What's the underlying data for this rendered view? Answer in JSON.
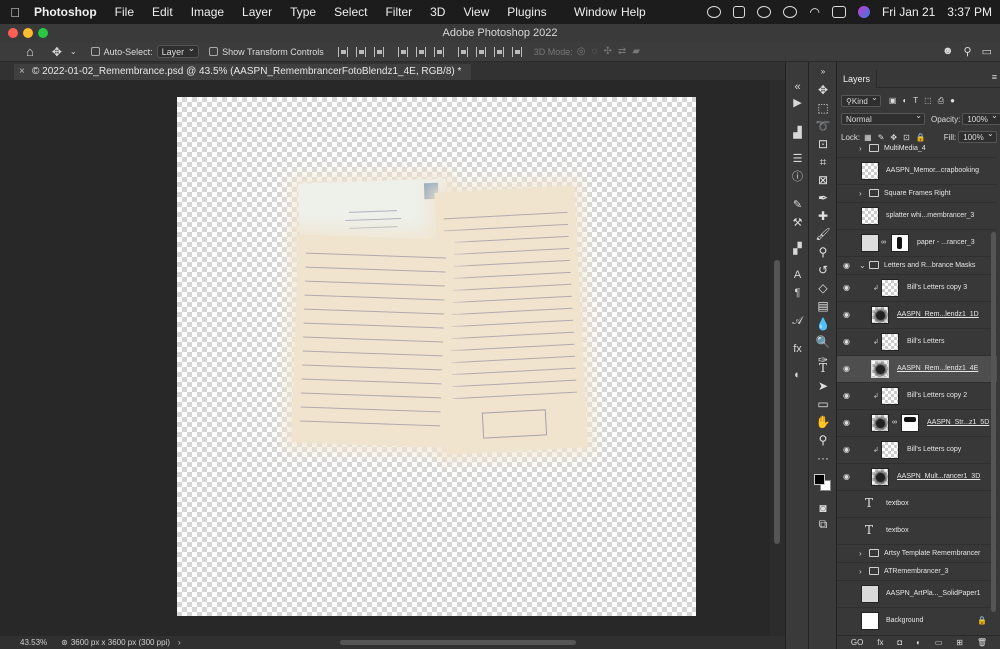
{
  "menubar": {
    "app_name": "Photoshop",
    "items": [
      "File",
      "Edit",
      "Image",
      "Layer",
      "Type",
      "Select",
      "Filter",
      "3D",
      "View",
      "Plugins"
    ],
    "right_items": [
      "Window",
      "Help"
    ],
    "date": "Fri Jan 21",
    "time": "3:37 PM"
  },
  "window": {
    "title": "Adobe Photoshop 2022"
  },
  "options_bar": {
    "auto_select_label": "Auto-Select:",
    "auto_select_value": "Layer",
    "show_transform_label": "Show Transform Controls",
    "mode_3d_label": "3D Mode:"
  },
  "document_tab": {
    "close": "×",
    "title": "© 2022-01-02_Remembrance.psd @ 43.5% (AASPN_RemembrancerFotoBlendz1_4E, RGB/8) *"
  },
  "status_bar": {
    "zoom": "43.53%",
    "doc_info": "3600 px x 3600 px (300 ppi)",
    "arrow": "›"
  },
  "layers_panel": {
    "tab_label": "Layers",
    "filter_kind": "Kind",
    "blend_mode": "Normal",
    "opacity_label": "Opacity:",
    "opacity_value": "100%",
    "lock_label": "Lock:",
    "fill_label": "Fill:",
    "fill_value": "100%",
    "bottom_icons": [
      "GO",
      "fx"
    ],
    "layers": [
      {
        "name": "MultiMedia_4",
        "kind": "group",
        "visible": false
      },
      {
        "name": "AASPN_Memor...crapbooking",
        "kind": "image",
        "visible": false
      },
      {
        "name": "Square Frames Right",
        "kind": "group",
        "visible": false
      },
      {
        "name": "splatter whi...membrancer_3",
        "kind": "image",
        "visible": false
      },
      {
        "name": "paper - ...rancer_3",
        "kind": "masked",
        "visible": false
      },
      {
        "name": "Letters and R...brance Masks",
        "kind": "group-open",
        "visible": true
      },
      {
        "name": "Bill's Letters copy 3",
        "kind": "clipped",
        "visible": true
      },
      {
        "name": "AASPN_Rem...lendz1_1D",
        "kind": "dark",
        "visible": true,
        "underline": true
      },
      {
        "name": "Bill's Letters",
        "kind": "clipped",
        "visible": true
      },
      {
        "name": "AASPN_Rem...lendz1_4E",
        "kind": "dark",
        "visible": true,
        "underline": true,
        "selected": true
      },
      {
        "name": "Bill's Letters copy 2",
        "kind": "clipped",
        "visible": true
      },
      {
        "name": "AASPN_Str...z1_5D",
        "kind": "dark-masked",
        "visible": true,
        "underline": true
      },
      {
        "name": "Bill's Letters copy",
        "kind": "clipped",
        "visible": true
      },
      {
        "name": "AASPN_Mult...rancer1_3D",
        "kind": "dark",
        "visible": true,
        "underline": true
      },
      {
        "name": "textbox",
        "kind": "text",
        "visible": false
      },
      {
        "name": "textbox",
        "kind": "text",
        "visible": false
      },
      {
        "name": "Artsy Template Remembrancer",
        "kind": "group",
        "visible": false
      },
      {
        "name": "ATRemembrancer_3",
        "kind": "group",
        "visible": false
      },
      {
        "name": "AASPN_ArtPla..._SolidPaper1",
        "kind": "plain",
        "visible": false
      },
      {
        "name": "Background",
        "kind": "background",
        "visible": false
      }
    ]
  },
  "icons": {
    "apple": "",
    "home": "⌂",
    "move": "✥",
    "layer_eye": "◉",
    "text_tool": "T",
    "lock": "🔒"
  }
}
